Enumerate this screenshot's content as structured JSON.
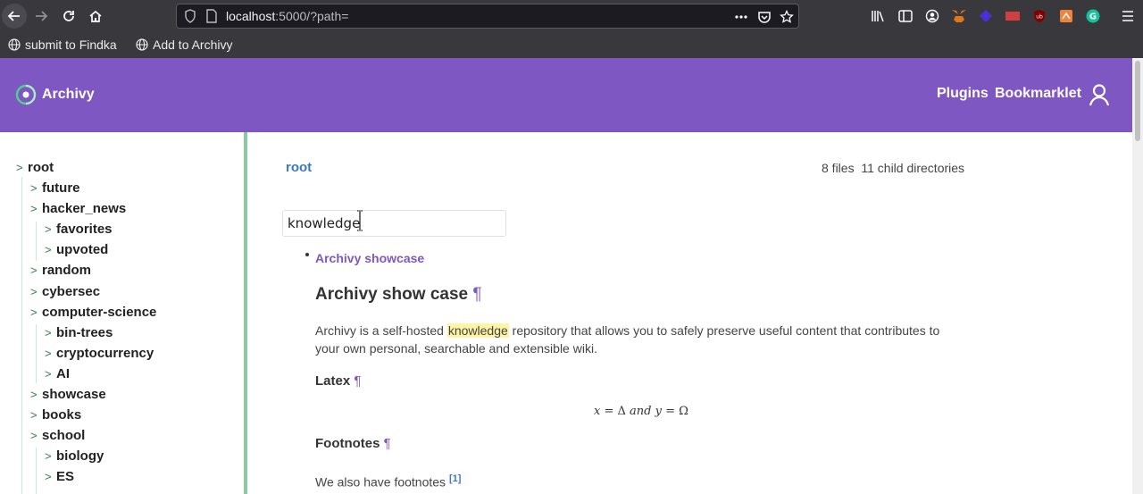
{
  "browser": {
    "url_host": "localhost",
    "url_rest": ":5000/?path=",
    "bookmarks": [
      {
        "label": "submit to Findka"
      },
      {
        "label": "Add to Archivy"
      }
    ]
  },
  "app": {
    "brand": "Archivy",
    "nav": {
      "plugins": "Plugins",
      "bookmarklet": "Bookmarklet"
    },
    "accent_color": "#7e57c2"
  },
  "sidebar": {
    "items": [
      {
        "label": "root",
        "depth": 0
      },
      {
        "label": "future",
        "depth": 1
      },
      {
        "label": "hacker_news",
        "depth": 1
      },
      {
        "label": "favorites",
        "depth": 2
      },
      {
        "label": "upvoted",
        "depth": 2
      },
      {
        "label": "random",
        "depth": 1
      },
      {
        "label": "cybersec",
        "depth": 1
      },
      {
        "label": "computer-science",
        "depth": 1
      },
      {
        "label": "bin-trees",
        "depth": 2
      },
      {
        "label": "cryptocurrency",
        "depth": 2
      },
      {
        "label": "AI",
        "depth": 2
      },
      {
        "label": "showcase",
        "depth": 1
      },
      {
        "label": "books",
        "depth": 1
      },
      {
        "label": "school",
        "depth": 1
      },
      {
        "label": "biology",
        "depth": 2
      },
      {
        "label": "ES",
        "depth": 2
      }
    ]
  },
  "main": {
    "breadcrumb": "root",
    "files": "8 files",
    "child_dirs": "11 child directories",
    "search_value": "knowledge",
    "result_title": "Archivy showcase",
    "doc": {
      "heading": "Archivy show case",
      "pilcrow": "¶",
      "intro_before": "Archivy is a self-hosted ",
      "intro_highlight": "knowledge",
      "intro_after": " repository that allows you to safely preserve useful content that contributes to your own personal, searchable and extensible wiki.",
      "latex_heading": "Latex",
      "footnotes_heading": "Footnotes",
      "footnote_text": "We also have footnotes",
      "footnote_ref": "[1]"
    }
  }
}
